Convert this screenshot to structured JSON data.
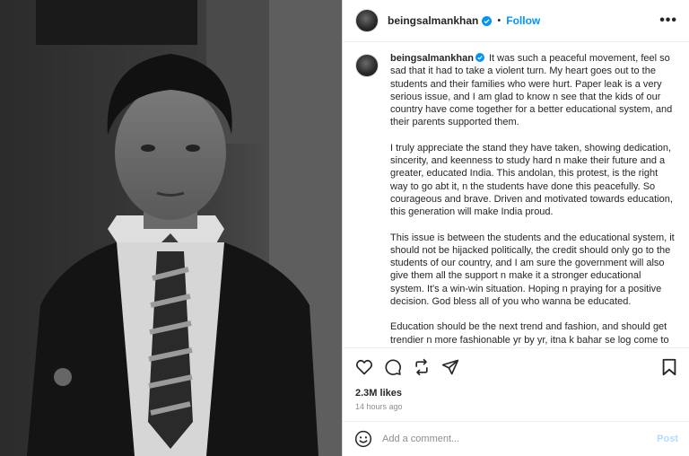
{
  "post": {
    "username": "beingsalmankhan",
    "separator": "•",
    "follow_label": "Follow",
    "more_label": "•••",
    "caption_paragraphs": [
      "It was such a peaceful movement, feel so sad that it had to take a violent turn. My heart goes out to the students and their families who were hurt. Paper leak is a very serious issue, and I am glad to know n see that the kids of our country have come together for a better educational system, and their parents supported them.",
      "I truly appreciate the stand they have taken, showing dedication, sincerity, and keenness to study hard n make their future and a greater, educated India. This andolan, this protest, is the right way to go abt it, n the students have done this peacefully. So courageous and brave. Driven and motivated towards education, this generation will make India proud.",
      "This issue is between the students and the educational system, it should not be hijacked politically, the credit should only go to the students of our country, and I am sure the government will also give them all the support n make it a stronger educational system. It's a win-win situation. Hoping n praying for a positive decision. God bless all of you who wanna be educated.",
      "Education should be the next trend and fashion, and should get trendier n more fashionable yr by yr, itna k bahar se log come to India to study and India becomes an educational hub."
    ],
    "likes": "2.3M likes",
    "time_ago": "14 hours ago"
  },
  "comment": {
    "placeholder": "Add a comment...",
    "post_label": "Post"
  },
  "icons": {
    "verified": "verified-badge-icon",
    "like": "heart-icon",
    "comment": "comment-icon",
    "share_repost": "repost-icon",
    "send": "send-icon",
    "save": "bookmark-icon",
    "emoji": "emoji-icon"
  },
  "colors": {
    "accent": "#0095f6",
    "post_disabled": "#b3dbff",
    "muted": "#8e8e8e"
  }
}
